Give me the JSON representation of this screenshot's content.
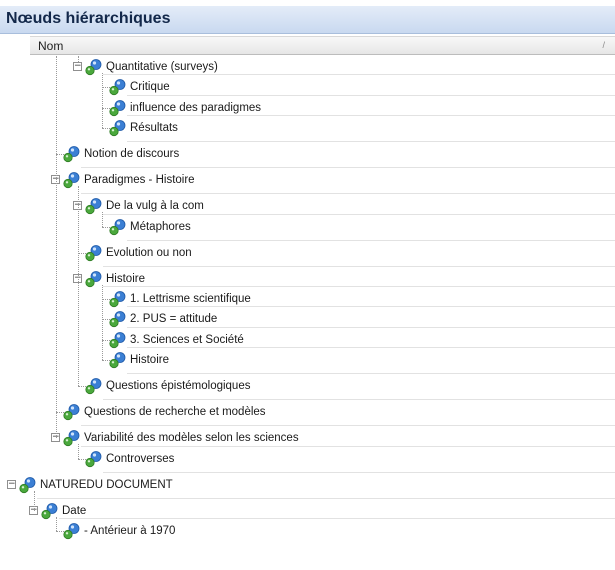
{
  "panel": {
    "title": "Nœuds hiérarchiques",
    "column_header": "Nom",
    "sort_glyph": "/"
  },
  "tree": {
    "nodes": [
      {
        "label": "Quantitative (surveys)",
        "level": 3,
        "expanded": true
      },
      {
        "label": "Critique",
        "level": 4
      },
      {
        "label": "influence des paradigmes",
        "level": 4
      },
      {
        "label": "Résultats",
        "level": 4
      },
      {
        "label": "Notion de discours",
        "level": 2
      },
      {
        "label": "Paradigmes - Histoire",
        "level": 2,
        "expanded": true
      },
      {
        "label": "De la vulg à la com",
        "level": 3,
        "expanded": true
      },
      {
        "label": "Métaphores",
        "level": 4
      },
      {
        "label": "Evolution ou non",
        "level": 3
      },
      {
        "label": "Histoire",
        "level": 3,
        "expanded": true
      },
      {
        "label": "1. Lettrisme scientifique",
        "level": 4
      },
      {
        "label": "2. PUS = attitude",
        "level": 4
      },
      {
        "label": "3. Sciences et Société",
        "level": 4
      },
      {
        "label": "Histoire",
        "level": 4
      },
      {
        "label": "Questions épistémologiques",
        "level": 3
      },
      {
        "label": "Questions de recherche et modèles",
        "level": 2
      },
      {
        "label": "Variabilité des modèles selon les sciences",
        "level": 2,
        "expanded": true
      },
      {
        "label": "Controverses",
        "level": 3
      },
      {
        "label": "NATUREDU DOCUMENT",
        "level": 0,
        "expanded": true
      },
      {
        "label": "Date",
        "level": 1,
        "expanded": true
      },
      {
        "label": "- Antérieur à 1970",
        "level": 2
      }
    ]
  },
  "icons": {
    "node": "node-cluster-icon",
    "expander": "collapse-toggle-icon"
  },
  "colors": {
    "title_bg": "#c9d9f0",
    "title_text": "#13284a",
    "icon_blue": "#3b7fd4",
    "icon_green": "#4aa83c",
    "guide_line": "#9a9a9a"
  }
}
